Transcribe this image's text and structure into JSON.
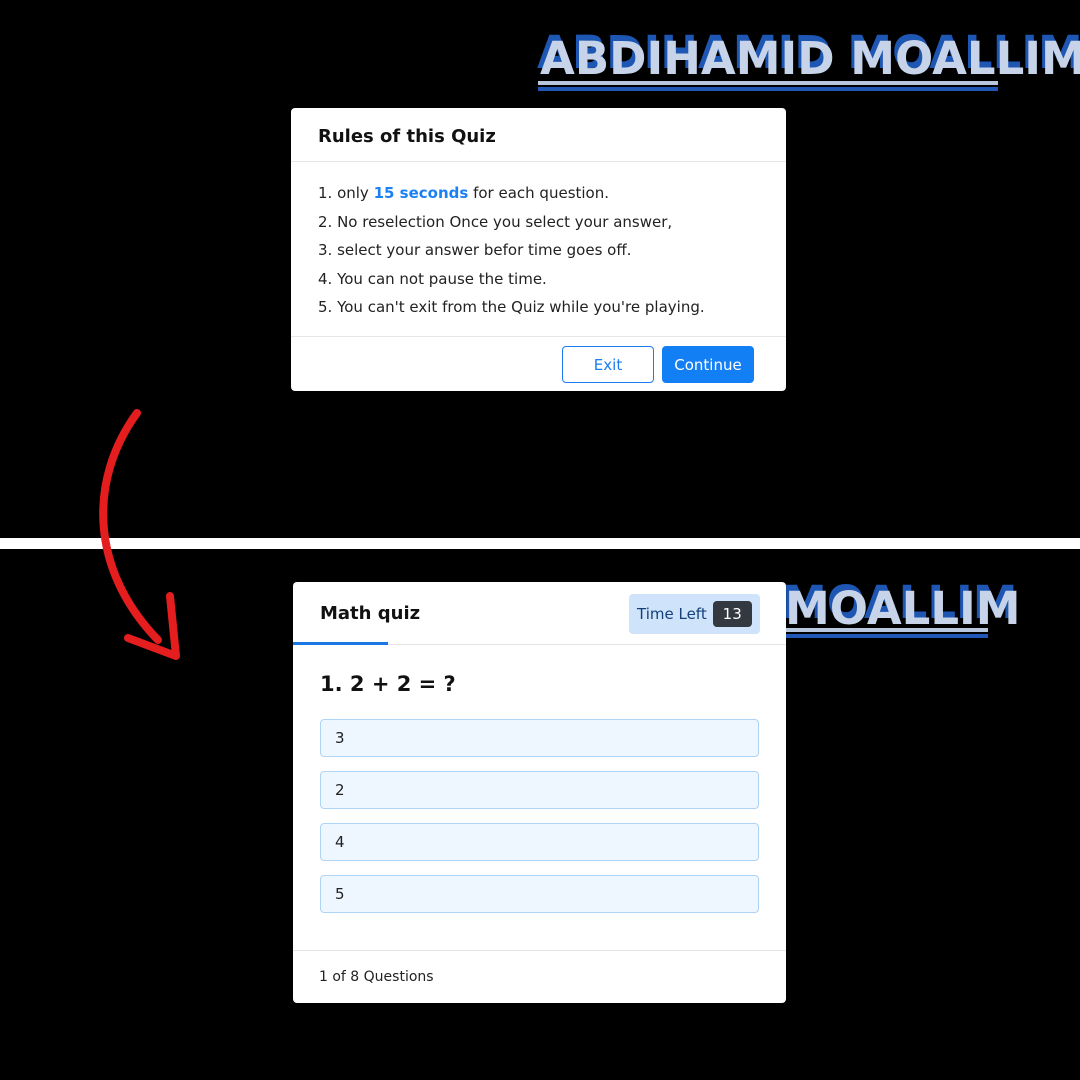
{
  "brand": {
    "top": "ABDIHAMID MOALLIM",
    "bottom": "MOALLIM"
  },
  "rules_modal": {
    "title": "Rules of this Quiz",
    "rules": [
      {
        "prefix": "1. only ",
        "highlight": "15 seconds",
        "suffix": " for each question."
      },
      {
        "text": "2. No reselection Once you select your answer,"
      },
      {
        "text": "3. select your answer befor time goes off."
      },
      {
        "text": "4. You can not pause the time."
      },
      {
        "text": "5. You can't exit from the Quiz while you're playing."
      }
    ],
    "exit_label": "Exit",
    "continue_label": "Continue"
  },
  "quiz": {
    "title": "Math quiz",
    "timer_label": "Time Left",
    "timer_value": "13",
    "question": "1. 2 + 2 = ?",
    "options": [
      "3",
      "2",
      "4",
      "5"
    ],
    "progress": "1 of 8 Questions"
  },
  "colors": {
    "accent": "#137ff5",
    "arrow": "#e41e1e",
    "brand_blue": "#1d56b3"
  },
  "icons": {
    "arrow": "curved-arrow-down"
  }
}
